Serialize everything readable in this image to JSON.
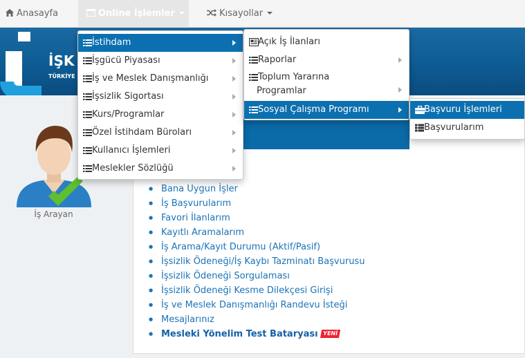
{
  "nav": {
    "home": "Anasayfa",
    "online": "Online İşlemler",
    "shortcuts": "Kısayollar"
  },
  "banner": {
    "logo_text": "İŞK",
    "logo_sub": "TÜRKİYE"
  },
  "profile": {
    "label": "İş Arayan"
  },
  "menu_main": [
    {
      "label": "İstihdam",
      "active": true
    },
    {
      "label": "İşgücü Piyasası"
    },
    {
      "label": "İş ve Meslek Danışmanlığı"
    },
    {
      "label": "İşsizlik Sigortası"
    },
    {
      "label": "Kurs/Programlar"
    },
    {
      "label": "Özel İstihdam Büroları"
    },
    {
      "label": "Kullanıcı İşlemleri"
    },
    {
      "label": "Meslekler Sözlüğü"
    }
  ],
  "menu_istihdam": [
    {
      "label": "Açık İş İlanları"
    },
    {
      "label": "Raporlar"
    },
    {
      "label": "Toplum Yararına",
      "label2": "Programlar"
    },
    {
      "label": "Sosyal Çalışma Programı",
      "active": true
    }
  ],
  "menu_sosyal": [
    {
      "label": "Başvuru İşlemleri",
      "active": true
    },
    {
      "label": "Başvurularım"
    }
  ],
  "links": [
    "Bana Uygun İşler",
    "İş Başvurularım",
    "Favori İlanlarım",
    "Kayıtlı Aramalarım",
    "İş Arama/Kayıt Durumu (Aktif/Pasif)",
    "İşsizlik Ödeneği/İş Kaybı Tazminatı Başvurusu",
    "İşsizlik Ödeneği Sorgulaması",
    "İşsizlik Ödeneği Kesme Dilekçesi Girişi",
    "İş ve Meslek Danışmanlığı Randevu İsteği",
    "Mesajlarınız",
    "Mesleki Yönelim Test Bataryası"
  ],
  "new_badge": "YENİ",
  "colors": {
    "accent": "#0c70b0",
    "banner": "#0d5a92",
    "link": "#1a73b8",
    "badge": "#ee2233"
  }
}
